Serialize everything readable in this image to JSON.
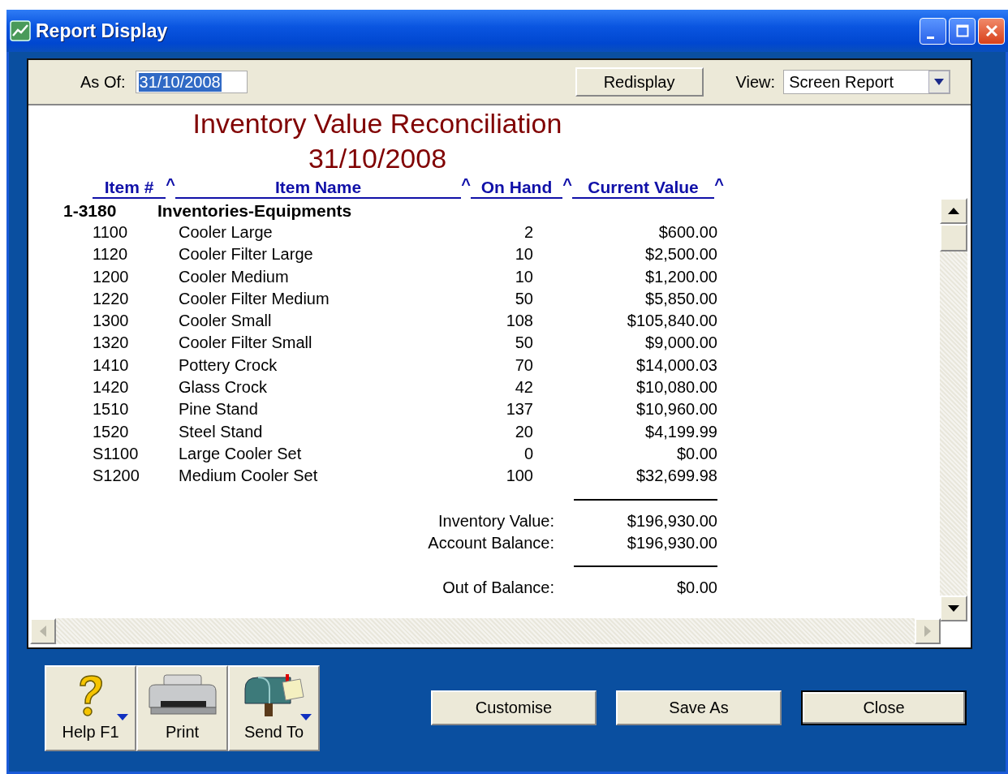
{
  "window": {
    "title": "Report Display"
  },
  "toolbar": {
    "as_of": {
      "label": "As Of:",
      "value": "31/10/2008",
      "text_selected": true
    },
    "redisplay": "Redisplay",
    "view": {
      "label": "View:",
      "value": "Screen Report"
    }
  },
  "report": {
    "title": "Inventory Value Reconciliation",
    "date": "31/10/2008",
    "columns": [
      {
        "label": "Item #",
        "sort_mark": "^"
      },
      {
        "label": "Item Name",
        "sort_mark": "^"
      },
      {
        "label": "On Hand",
        "sort_mark": "^"
      },
      {
        "label": "Current Value",
        "sort_mark": "^"
      }
    ],
    "group": {
      "account": "1-3180",
      "name": "Inventories-Equipments"
    },
    "rows": [
      {
        "item": "1100",
        "name": "Cooler Large",
        "on_hand": "2",
        "value": "$600.00"
      },
      {
        "item": "1120",
        "name": "Cooler Filter Large",
        "on_hand": "10",
        "value": "$2,500.00"
      },
      {
        "item": "1200",
        "name": "Cooler Medium",
        "on_hand": "10",
        "value": "$1,200.00"
      },
      {
        "item": "1220",
        "name": "Cooler Filter Medium",
        "on_hand": "50",
        "value": "$5,850.00"
      },
      {
        "item": "1300",
        "name": "Cooler Small",
        "on_hand": "108",
        "value": "$105,840.00"
      },
      {
        "item": "1320",
        "name": "Cooler Filter Small",
        "on_hand": "50",
        "value": "$9,000.00"
      },
      {
        "item": "1410",
        "name": "Pottery Crock",
        "on_hand": "70",
        "value": "$14,000.03"
      },
      {
        "item": "1420",
        "name": "Glass Crock",
        "on_hand": "42",
        "value": "$10,080.00"
      },
      {
        "item": "1510",
        "name": "Pine Stand",
        "on_hand": "137",
        "value": "$10,960.00"
      },
      {
        "item": "1520",
        "name": "Steel Stand",
        "on_hand": "20",
        "value": "$4,199.99"
      },
      {
        "item": "S1100",
        "name": "Large Cooler Set",
        "on_hand": "0",
        "value": "$0.00"
      },
      {
        "item": "S1200",
        "name": "Medium Cooler Set",
        "on_hand": "100",
        "value": "$32,699.98"
      }
    ],
    "totals": [
      {
        "label": "Inventory Value:",
        "value": "$196,930.00",
        "rule_above": true
      },
      {
        "label": "Account Balance:",
        "value": "$196,930.00",
        "rule_above": false
      },
      {
        "label": "Out of Balance:",
        "value": "$0.00",
        "rule_above": true
      }
    ]
  },
  "tool_buttons": [
    {
      "label": "Help F1",
      "kind": "help",
      "dropdown": true
    },
    {
      "label": "Print",
      "kind": "print",
      "dropdown": false
    },
    {
      "label": "Send To",
      "kind": "send",
      "dropdown": true
    }
  ],
  "buttons": [
    {
      "label": "Customise",
      "default": false
    },
    {
      "label": "Save As",
      "default": false
    },
    {
      "label": "Close",
      "default": true
    }
  ]
}
